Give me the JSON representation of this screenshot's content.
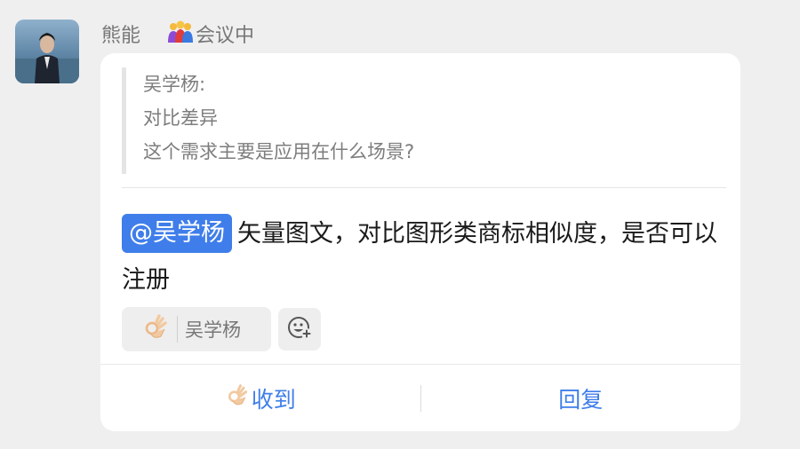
{
  "sender": {
    "name": "熊能",
    "status_text": "会议中",
    "status_icon": "people-group-icon"
  },
  "quote": {
    "author": "吴学杨:",
    "lines": [
      "对比差异",
      "这个需求主要是应用在什么场景?"
    ]
  },
  "message": {
    "mention": "@吴学杨",
    "text": "矢量图文，对比图形类商标相似度，是否可以注册"
  },
  "reactions": [
    {
      "emoji": "ok-hand-icon",
      "users": "吴学杨"
    }
  ],
  "actions": {
    "received_label": "收到",
    "reply_label": "回复"
  },
  "colors": {
    "accent": "#3f7eea",
    "card_bg": "#ffffff",
    "page_bg": "#efeff0"
  }
}
